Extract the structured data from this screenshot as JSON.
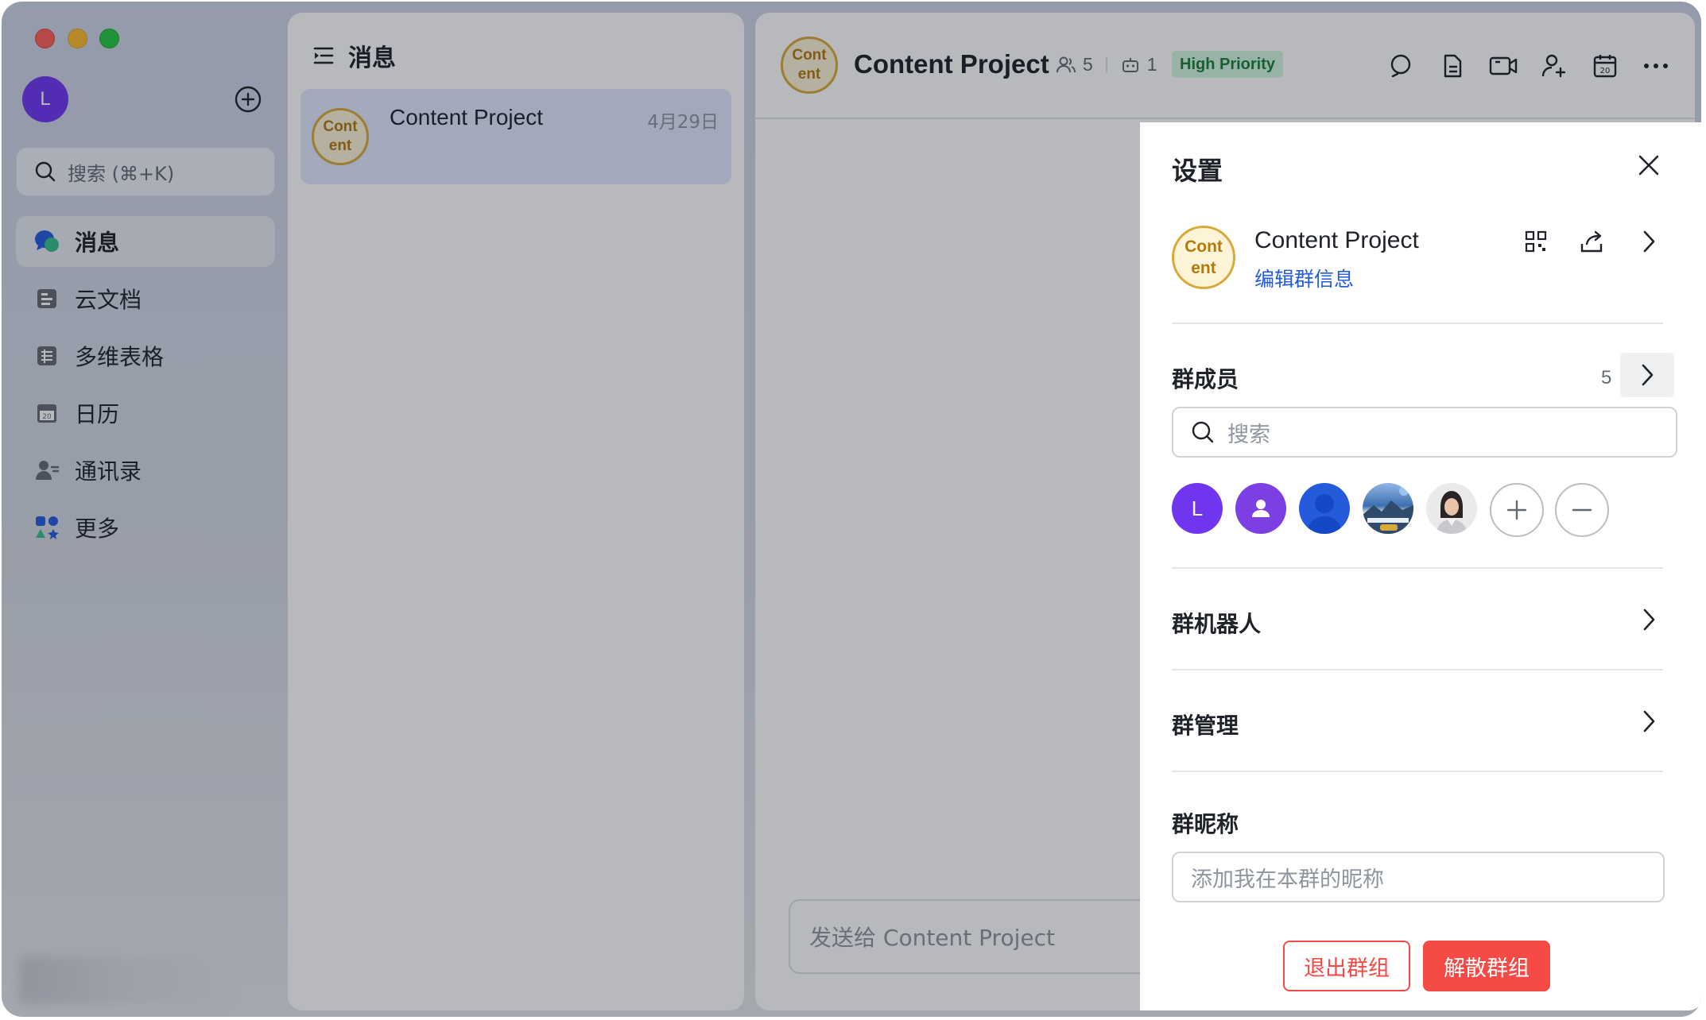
{
  "nav": {
    "user_initial": "L",
    "search_placeholder": "搜索 (⌘+K)",
    "items": [
      {
        "label": "消息",
        "icon": "messages-icon",
        "active": true
      },
      {
        "label": "云文档",
        "icon": "docs-icon"
      },
      {
        "label": "多维表格",
        "icon": "base-table-icon"
      },
      {
        "label": "日历",
        "icon": "calendar-icon"
      },
      {
        "label": "通讯录",
        "icon": "contacts-icon"
      },
      {
        "label": "更多",
        "icon": "more-apps-icon"
      }
    ]
  },
  "list": {
    "title": "消息",
    "conversations": [
      {
        "avatar_line1": "Cont",
        "avatar_line2": "ent",
        "name": "Content Project",
        "date": "4月29日"
      }
    ]
  },
  "chat": {
    "title": "Content Project",
    "member_count": "5",
    "bot_count": "1",
    "tag": "High Priority",
    "avatar_line1": "Cont",
    "avatar_line2": "ent",
    "composer_placeholder": "发送给 Content Project"
  },
  "settings": {
    "title": "设置",
    "group_name": "Content Project",
    "edit_link": "编辑群信息",
    "avatar_line1": "Cont",
    "avatar_line2": "ent",
    "members_label": "群成员",
    "members_count": "5",
    "member_search_placeholder": "搜索",
    "member_avatars": [
      {
        "type": "initial",
        "text": "L",
        "color": "#6f35ef"
      },
      {
        "type": "person-icon",
        "color": "#7b3fe4"
      },
      {
        "type": "person-icon",
        "color": "#245bdb"
      },
      {
        "type": "photo",
        "name": "landscape-photo"
      },
      {
        "type": "photo",
        "name": "woman-portrait"
      }
    ],
    "bots_label": "群机器人",
    "manage_label": "群管理",
    "nickname_label": "群昵称",
    "nickname_placeholder": "添加我在本群的昵称",
    "leave_button": "退出群组",
    "disband_button": "解散群组"
  },
  "colors": {
    "accent_blue": "#245bdb",
    "danger_red": "#f54a45",
    "tag_green": "#1a7f39",
    "avatar_gold": "#d9a938"
  }
}
